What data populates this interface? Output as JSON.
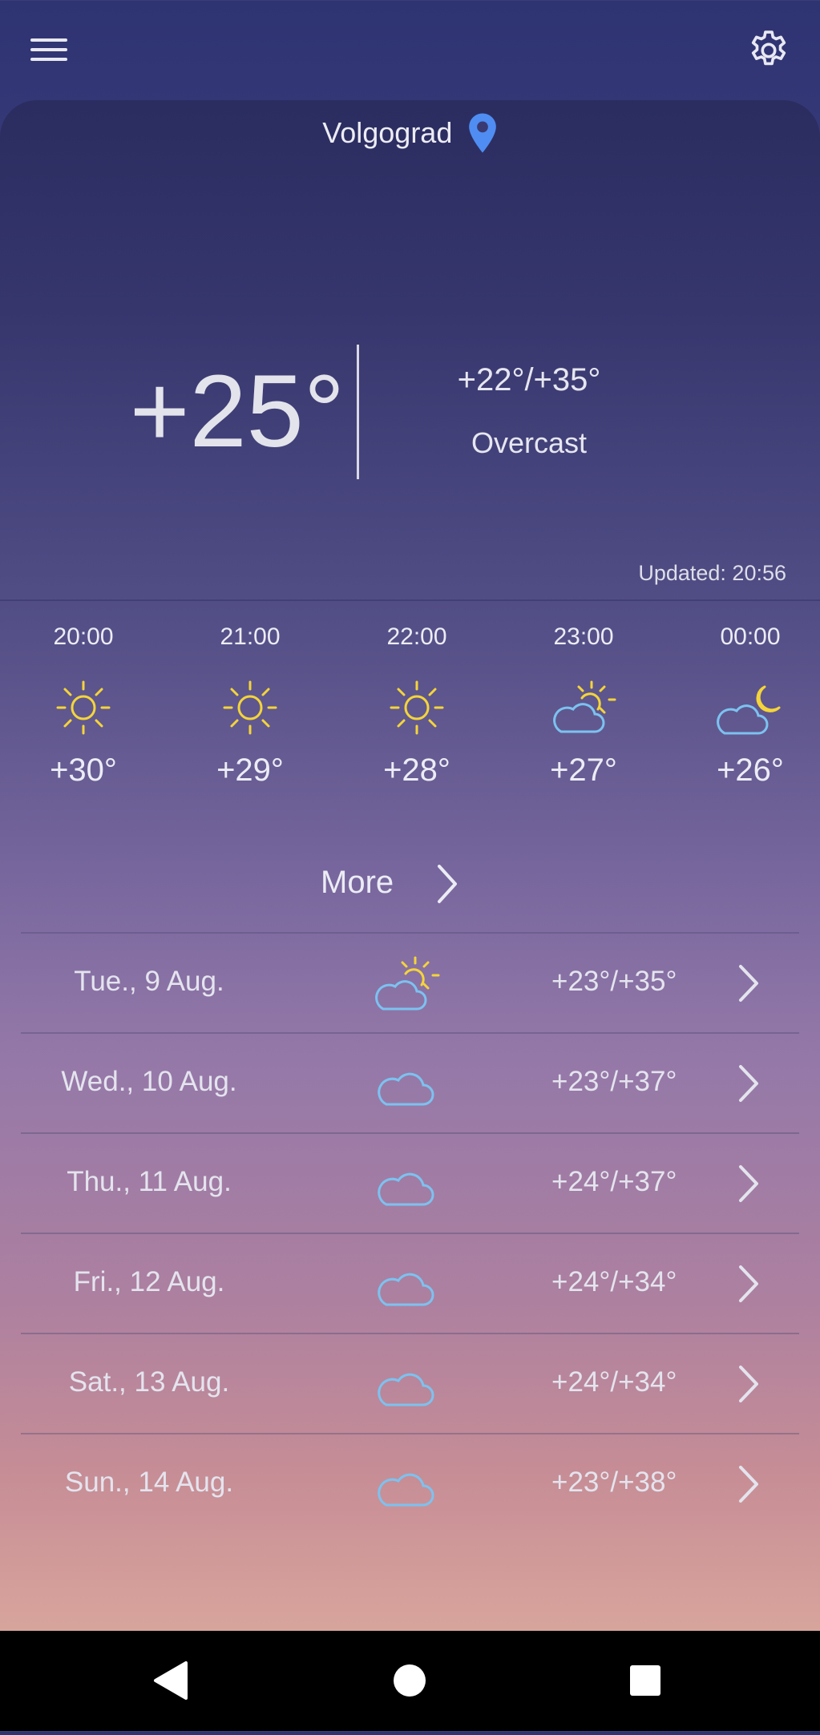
{
  "location": {
    "name": "Volgograd"
  },
  "current": {
    "temp": "+25°",
    "minmax": "+22°/+35°",
    "condition": "Overcast",
    "updated": "Updated: 20:56"
  },
  "hourly": [
    {
      "time": "20:00",
      "temp": "+30°",
      "icon": "sun-icon"
    },
    {
      "time": "21:00",
      "temp": "+29°",
      "icon": "sun-icon"
    },
    {
      "time": "22:00",
      "temp": "+28°",
      "icon": "sun-icon"
    },
    {
      "time": "23:00",
      "temp": "+27°",
      "icon": "partly-cloudy-icon"
    },
    {
      "time": "00:00",
      "temp": "+26°",
      "icon": "cloudy-night-icon"
    }
  ],
  "more_label": "More",
  "daily": [
    {
      "date": "Tue., 9 Aug.",
      "temps": "+23°/+35°",
      "icon": "partly-cloudy-icon"
    },
    {
      "date": "Wed., 10 Aug.",
      "temps": "+23°/+37°",
      "icon": "cloud-icon"
    },
    {
      "date": "Thu., 11 Aug.",
      "temps": "+24°/+37°",
      "icon": "cloud-icon"
    },
    {
      "date": "Fri., 12 Aug.",
      "temps": "+24°/+34°",
      "icon": "cloud-icon"
    },
    {
      "date": "Sat., 13 Aug.",
      "temps": "+24°/+34°",
      "icon": "cloud-icon"
    },
    {
      "date": "Sun., 14 Aug.",
      "temps": "+23°/+38°",
      "icon": "cloud-icon"
    }
  ],
  "colors": {
    "sun": "#f4d43a",
    "cloud": "#7cc2f0",
    "pin": "#4f8df2"
  }
}
